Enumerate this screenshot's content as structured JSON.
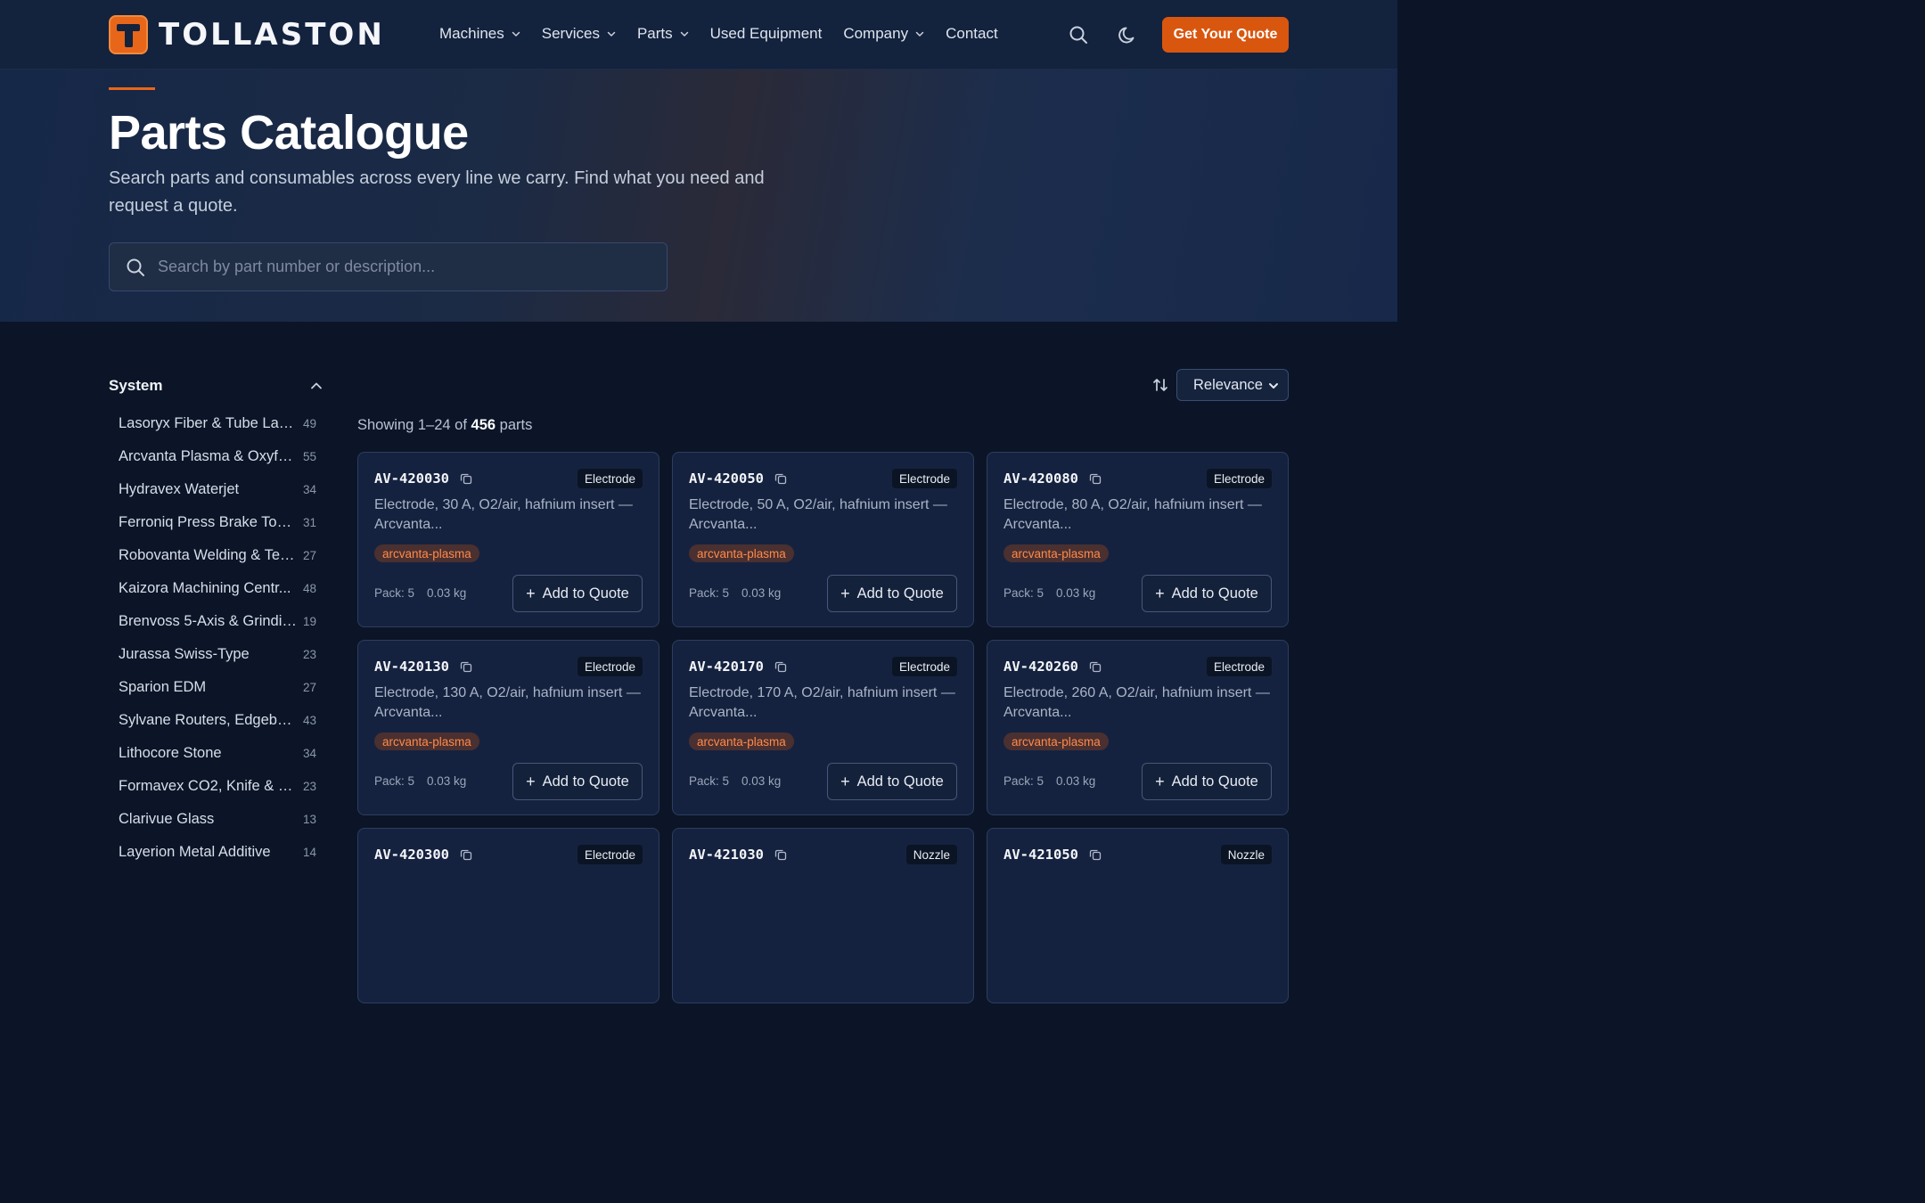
{
  "header": {
    "brand": "TOLLASTON",
    "nav": [
      {
        "label": "Machines",
        "has_dropdown": true
      },
      {
        "label": "Services",
        "has_dropdown": true
      },
      {
        "label": "Parts",
        "has_dropdown": true
      },
      {
        "label": "Used Equipment",
        "has_dropdown": false
      },
      {
        "label": "Company",
        "has_dropdown": true
      },
      {
        "label": "Contact",
        "has_dropdown": false
      }
    ],
    "cta": "Get Your Quote",
    "icons": {
      "search": "search-icon",
      "theme": "moon-icon"
    }
  },
  "hero": {
    "title": "Parts Catalogue",
    "subtitle": "Search parts and consumables across every line we carry. Find what you need and request a quote.",
    "search_placeholder": "Search by part number or description..."
  },
  "filters": {
    "title": "System",
    "items": [
      {
        "label": "Lasoryx Fiber & Tube Laser",
        "count": "49"
      },
      {
        "label": "Arcvanta Plasma & Oxyfuel",
        "count": "55"
      },
      {
        "label": "Hydravex Waterjet",
        "count": "34"
      },
      {
        "label": "Ferroniq Press Brake Tool...",
        "count": "31"
      },
      {
        "label": "Robovanta Welding & Ten...",
        "count": "27"
      },
      {
        "label": "Kaizora Machining Centr...",
        "count": "48"
      },
      {
        "label": "Brenvoss 5-Axis & Grinding",
        "count": "19"
      },
      {
        "label": "Jurassa Swiss-Type",
        "count": "23"
      },
      {
        "label": "Sparion EDM",
        "count": "27"
      },
      {
        "label": "Sylvane Routers, Edgeba...",
        "count": "43"
      },
      {
        "label": "Lithocore Stone",
        "count": "34"
      },
      {
        "label": "Formavex CO2, Knife & F...",
        "count": "23"
      },
      {
        "label": "Clarivue Glass",
        "count": "13"
      },
      {
        "label": "Layerion Metal Additive",
        "count": "14"
      }
    ]
  },
  "sort": {
    "selected": "Relevance"
  },
  "results": {
    "prefix": "Showing 1–24 of",
    "total": "456",
    "suffix": "parts"
  },
  "cards": [
    {
      "part_number": "AV-420030",
      "category": "Electrode",
      "description": "Electrode, 30 A, O2/air, hafnium insert — Arcvanta...",
      "tag": "arcvanta-plasma",
      "pack": "Pack: 5",
      "weight": "0.03 kg",
      "button": "Add to Quote"
    },
    {
      "part_number": "AV-420050",
      "category": "Electrode",
      "description": "Electrode, 50 A, O2/air, hafnium insert — Arcvanta...",
      "tag": "arcvanta-plasma",
      "pack": "Pack: 5",
      "weight": "0.03 kg",
      "button": "Add to Quote"
    },
    {
      "part_number": "AV-420080",
      "category": "Electrode",
      "description": "Electrode, 80 A, O2/air, hafnium insert — Arcvanta...",
      "tag": "arcvanta-plasma",
      "pack": "Pack: 5",
      "weight": "0.03 kg",
      "button": "Add to Quote"
    },
    {
      "part_number": "AV-420130",
      "category": "Electrode",
      "description": "Electrode, 130 A, O2/air, hafnium insert — Arcvanta...",
      "tag": "arcvanta-plasma",
      "pack": "Pack: 5",
      "weight": "0.03 kg",
      "button": "Add to Quote"
    },
    {
      "part_number": "AV-420170",
      "category": "Electrode",
      "description": "Electrode, 170 A, O2/air, hafnium insert — Arcvanta...",
      "tag": "arcvanta-plasma",
      "pack": "Pack: 5",
      "weight": "0.03 kg",
      "button": "Add to Quote"
    },
    {
      "part_number": "AV-420260",
      "category": "Electrode",
      "description": "Electrode, 260 A, O2/air, hafnium insert — Arcvanta...",
      "tag": "arcvanta-plasma",
      "pack": "Pack: 5",
      "weight": "0.03 kg",
      "button": "Add to Quote"
    },
    {
      "part_number": "AV-420300",
      "category": "Electrode",
      "description": "",
      "tag": "",
      "pack": "",
      "weight": "",
      "button": ""
    },
    {
      "part_number": "AV-421030",
      "category": "Nozzle",
      "description": "",
      "tag": "",
      "pack": "",
      "weight": "",
      "button": ""
    },
    {
      "part_number": "AV-421050",
      "category": "Nozzle",
      "description": "",
      "tag": "",
      "pack": "",
      "weight": "",
      "button": ""
    }
  ],
  "colors": {
    "accent": "#d9560f",
    "background": "#0b1527",
    "card": "#15223f",
    "tag_text": "#ff8a4a"
  }
}
